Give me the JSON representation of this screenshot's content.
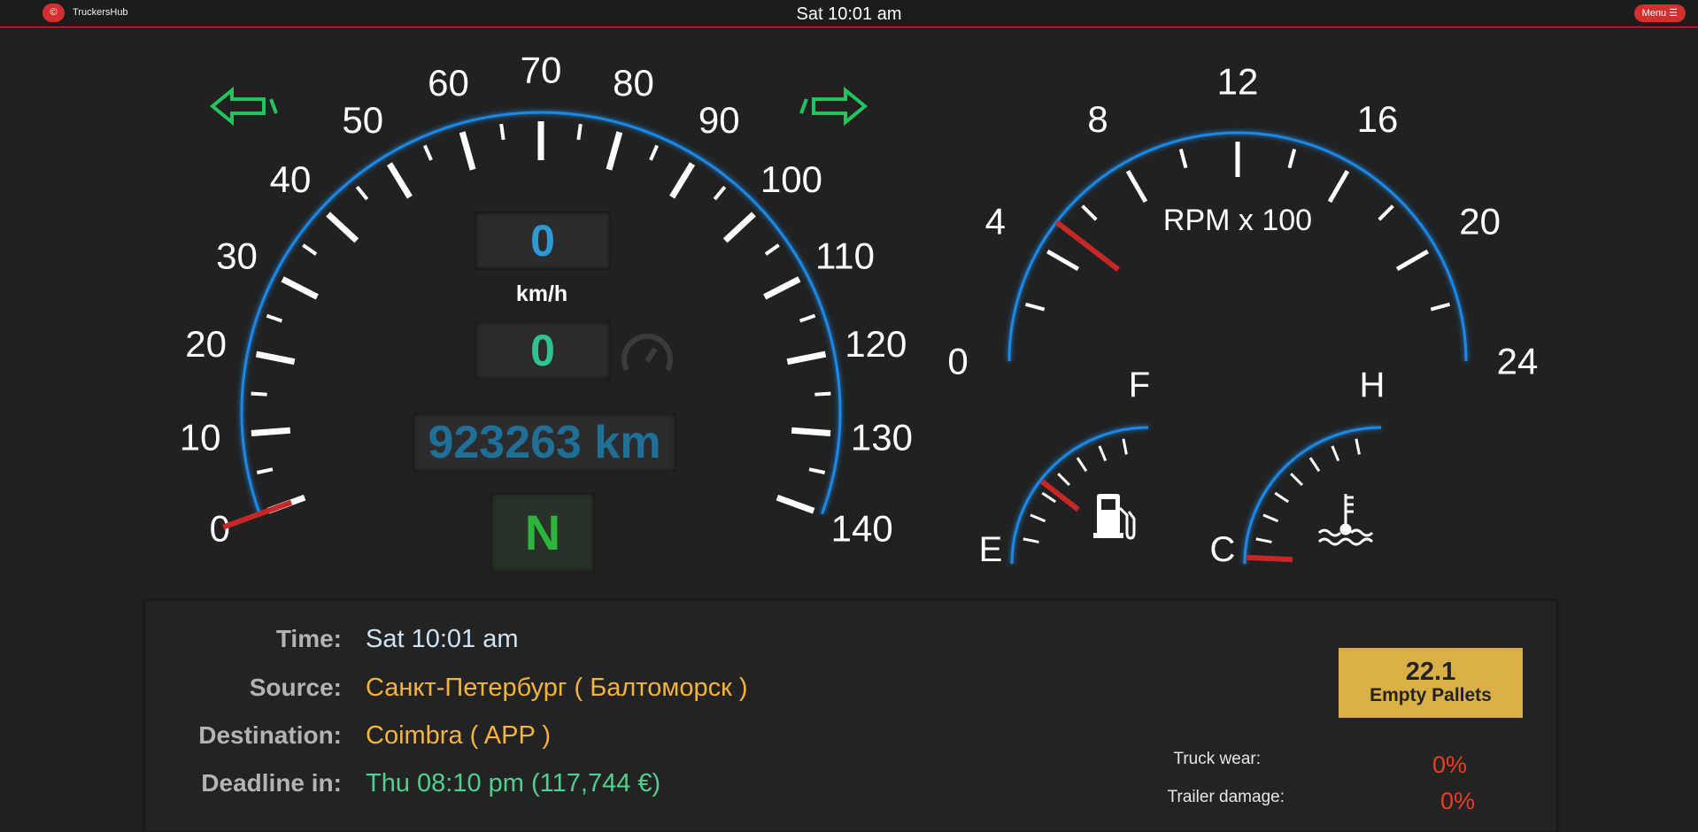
{
  "topbar": {
    "logo_symbol": "©",
    "app_name": "TruckersHub",
    "clock": "Sat 10:01 am",
    "menu_label": "Menu ☰"
  },
  "speedometer": {
    "scale_labels": [
      "0",
      "10",
      "20",
      "30",
      "40",
      "50",
      "60",
      "70",
      "80",
      "90",
      "100",
      "110",
      "120",
      "130",
      "140"
    ],
    "max": 140,
    "needle_value": 0,
    "speed": "0",
    "unit": "km/h",
    "cruise_speed": "0",
    "odometer": "923263 km",
    "gear": "N",
    "left_indicator": "left-arrow-icon",
    "right_indicator": "right-arrow-icon",
    "cruise_icon": "speedometer-icon"
  },
  "rpm_gauge": {
    "scale_labels": [
      "0",
      "4",
      "8",
      "12",
      "16",
      "20",
      "24"
    ],
    "max": 24,
    "needle_value": 5,
    "label": "RPM x 100"
  },
  "fuel_gauge": {
    "min_label": "E",
    "max_label": "F",
    "level": 0.42,
    "icon": "fuel-pump-icon"
  },
  "temp_gauge": {
    "min_label": "C",
    "max_label": "H",
    "level": 0.03,
    "icon": "coolant-temperature-icon"
  },
  "info": {
    "rows": [
      {
        "label": "Time:",
        "value": "Sat 10:01 am",
        "color": "#cfe3f2"
      },
      {
        "label": "Source:",
        "value": "Санкт-Петербург ( Балтоморск )",
        "color": "#f3b33d"
      },
      {
        "label": "Destination:",
        "value": "Coimbra ( APP )",
        "color": "#f3b33d"
      },
      {
        "label": "Deadline in:",
        "value": "Thu 08:10 pm (117,744 €)",
        "color": "#4fd08f"
      }
    ]
  },
  "cargo": {
    "weight": "22.1",
    "name": "Empty Pallets",
    "truck_wear_label": "Truck wear:",
    "truck_wear_value": "0%",
    "trailer_damage_label": "Trailer damage:",
    "trailer_damage_value": "0%"
  },
  "colors": {
    "accent_blue": "#1e88e5",
    "needle_red": "#c62828",
    "indicator_green": "#21c45d",
    "menu_red": "#d32f2f",
    "cargo_gold": "#dab046"
  }
}
